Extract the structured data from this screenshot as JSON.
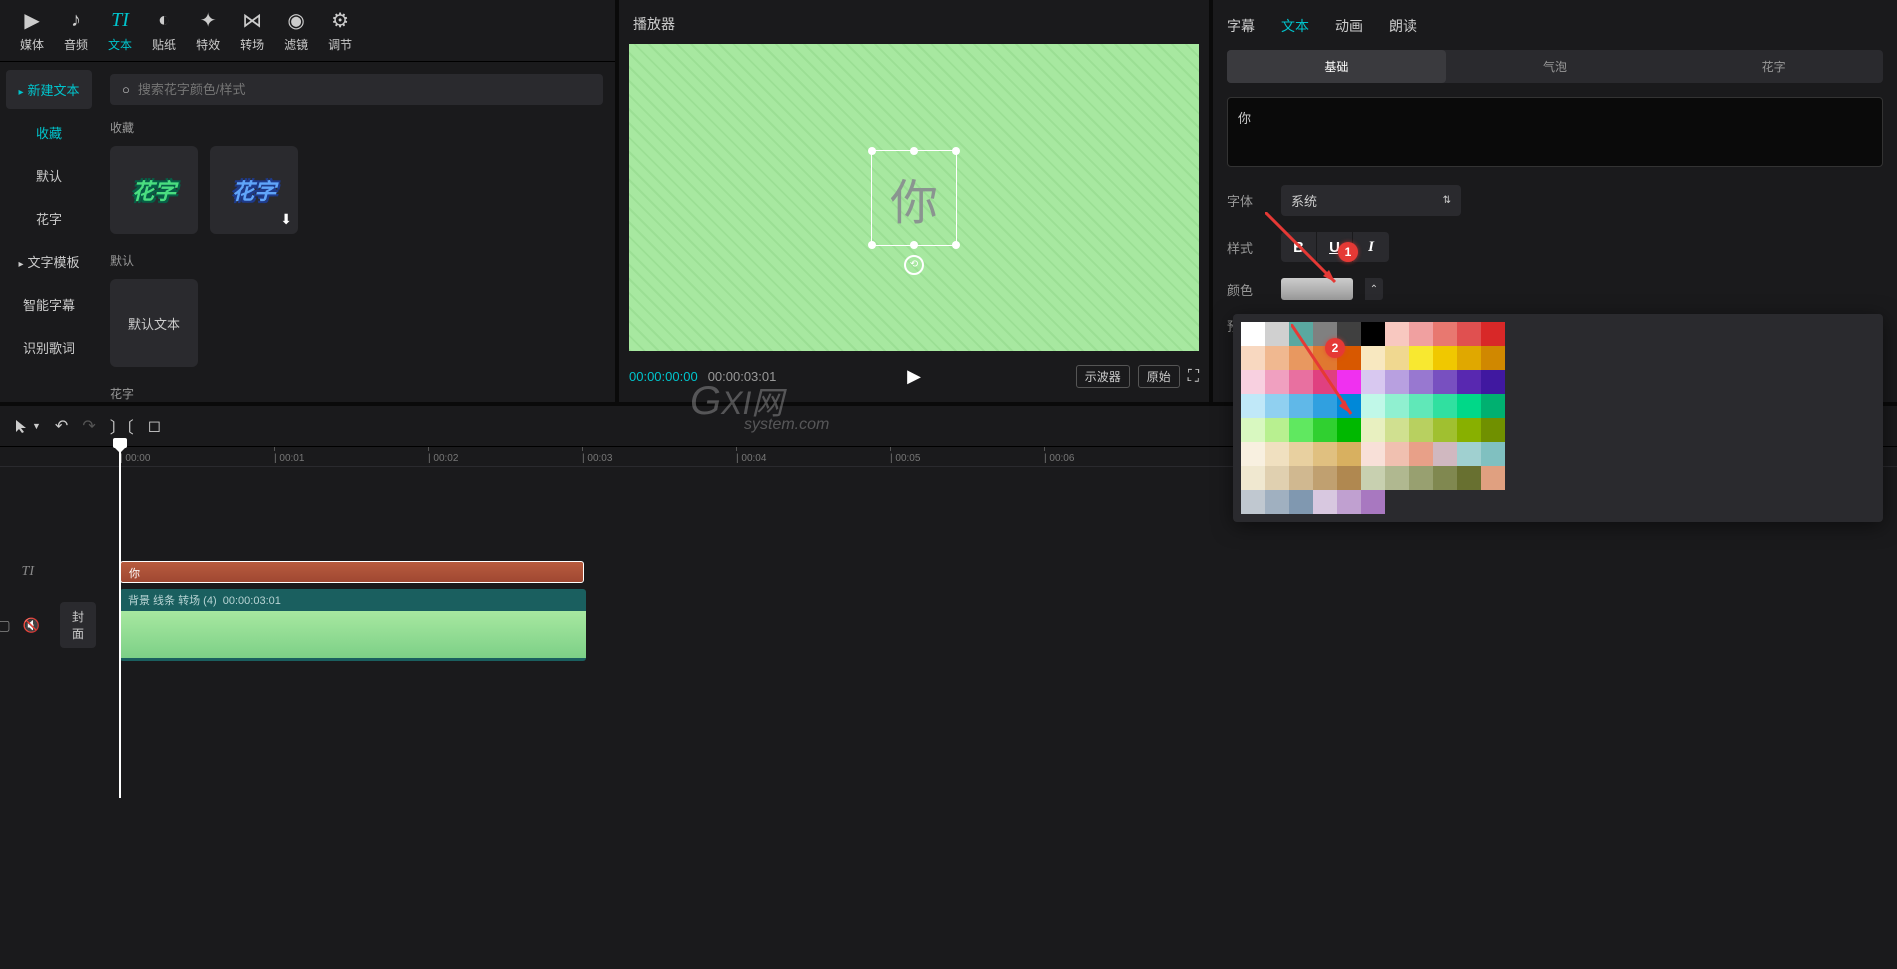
{
  "toolbar": {
    "tabs": [
      {
        "icon": "▶",
        "label": "媒体"
      },
      {
        "icon": "♪",
        "label": "音频"
      },
      {
        "icon": "TI",
        "label": "文本"
      },
      {
        "icon": "◐",
        "label": "贴纸"
      },
      {
        "icon": "✦",
        "label": "特效"
      },
      {
        "icon": "⋈",
        "label": "转场"
      },
      {
        "icon": "◉",
        "label": "滤镜"
      },
      {
        "icon": "⚙",
        "label": "调节"
      }
    ]
  },
  "sidebar": {
    "newtext": "新建文本",
    "items": [
      "收藏",
      "默认",
      "花字",
      "文字模板",
      "智能字幕",
      "识别歌词"
    ]
  },
  "search": {
    "placeholder": "搜索花字颜色/样式"
  },
  "sections": {
    "fav_label": "收藏",
    "thumb1": "花字",
    "thumb2": "花字",
    "default_label": "默认",
    "default_thumb": "默认文本",
    "huazi_label": "花字"
  },
  "player": {
    "title": "播放器",
    "textbox_char": "你",
    "time_current": "00:00:00:00",
    "time_total": "00:00:03:01",
    "btn_oscilloscope": "示波器",
    "btn_original": "原始"
  },
  "inspector": {
    "tabs": [
      "字幕",
      "文本",
      "动画",
      "朗读"
    ],
    "subtabs": [
      "基础",
      "气泡",
      "花字"
    ],
    "text_value": "你",
    "font_label": "字体",
    "font_value": "系统",
    "style_label": "样式",
    "bold": "B",
    "underline": "U",
    "italic": "I",
    "color_label": "颜色",
    "preview_label": "预"
  },
  "badges": {
    "one": "1",
    "two": "2"
  },
  "palette": {
    "rows": [
      [
        "#ffffff",
        "#d0d0d0",
        "#5aa8a0",
        "#808080",
        "#404040",
        "#000000",
        "#f8c8c0",
        "#f0a0a0",
        "#e87870",
        "#e05050",
        "#d82828"
      ],
      [
        "#f8d8c0",
        "#f0b890",
        "#e89860",
        "#e07830",
        "#d85800",
        "#f8e8c0",
        "#f0d890",
        "#f8e830",
        "#f0c800",
        "#e0a800",
        "#d08800"
      ],
      [
        "#f8d0e0",
        "#f0a0c0",
        "#e870a0",
        "#e04080",
        "#f030f0",
        "#d8c8f0",
        "#b8a0e0",
        "#9878d0",
        "#7850c0",
        "#5828b0",
        "#4018a0"
      ],
      [
        "#c0e8f8",
        "#90d0f0",
        "#60b8e8",
        "#30a0e0",
        "#0088d8",
        "#c0f8e8",
        "#90f0d0",
        "#60e8b8",
        "#30e0a0",
        "#00d888",
        "#00b070"
      ],
      [
        "#d8f8c0",
        "#b8f090",
        "#60e860",
        "#30d030",
        "#00b800",
        "#e8f0c0",
        "#d0e090",
        "#b8d060",
        "#a0c030",
        "#88b000",
        "#709000"
      ],
      [
        "#f8f0e0",
        "#f0e0c0",
        "#e8d0a0",
        "#e0c080",
        "#d8b060",
        "#f8e0d8",
        "#f0c0b0",
        "#e8a088",
        "#d0b8c0",
        "#a0d0d0",
        "#80c0c0"
      ],
      [
        "#f0e8d0",
        "#e0d0b0",
        "#d0b890",
        "#c0a070",
        "#b08850",
        "#c8d0b0",
        "#b0b890",
        "#98a070",
        "#808850",
        "#687030",
        "#e0a080"
      ],
      [
        "#c0c8d0",
        "#a0b0c0",
        "#8098b0",
        "#d8c8e0",
        "#c0a0d0",
        "#a878c0",
        "",
        "",
        "",
        "",
        ""
      ]
    ]
  },
  "timeline": {
    "ruler": [
      "00:00",
      "00:01",
      "00:02",
      "00:03",
      "00:04",
      "00:05",
      "00:06"
    ],
    "text_clip": "你",
    "video_clip_label": "背景 线条 转场 (4)",
    "video_clip_time": "00:00:03:01",
    "cover": "封面"
  },
  "watermark": {
    "main": "GXI网",
    "sub": "system.com"
  }
}
